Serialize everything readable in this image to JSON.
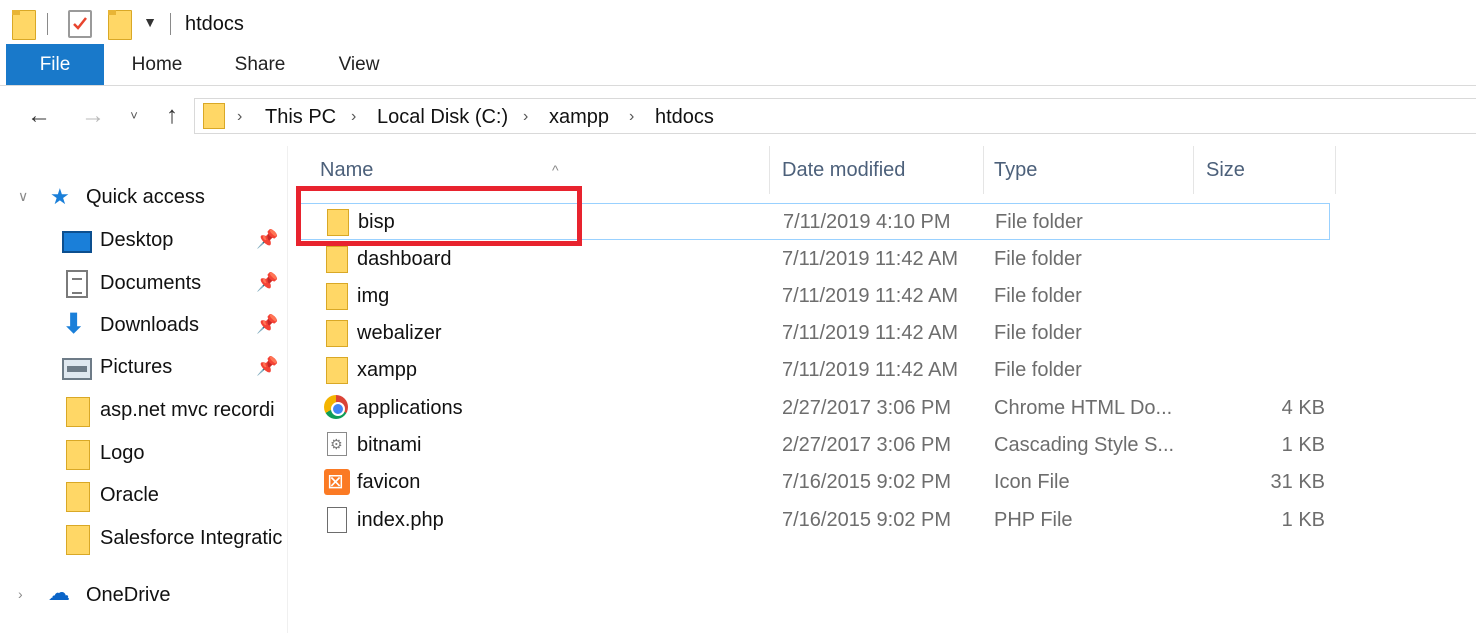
{
  "window": {
    "title": "htdocs"
  },
  "ribbon": {
    "tabs": [
      {
        "label": "File",
        "active": true
      },
      {
        "label": "Home"
      },
      {
        "label": "Share"
      },
      {
        "label": "View"
      }
    ]
  },
  "navigation": {
    "back": "←",
    "forward": "→",
    "recent": "˅",
    "up": "↑"
  },
  "address": {
    "crumbs": [
      "This PC",
      "Local Disk (C:)",
      "xampp",
      "htdocs"
    ],
    "separator": "›"
  },
  "navpane": {
    "quick_access": "Quick access",
    "items": [
      {
        "label": "Desktop",
        "icon": "desktop-icon",
        "pinned": true
      },
      {
        "label": "Documents",
        "icon": "documents-icon",
        "pinned": true
      },
      {
        "label": "Downloads",
        "icon": "downloads-icon",
        "pinned": true
      },
      {
        "label": "Pictures",
        "icon": "pictures-icon",
        "pinned": true
      },
      {
        "label": "asp.net mvc recordi",
        "icon": "folder-icon"
      },
      {
        "label": "Logo",
        "icon": "folder-icon"
      },
      {
        "label": "Oracle",
        "icon": "folder-icon"
      },
      {
        "label": "Salesforce Integratic",
        "icon": "folder-icon"
      }
    ],
    "onedrive": "OneDrive",
    "pin_glyph": "📌"
  },
  "filelist": {
    "columns": {
      "name": "Name",
      "date": "Date modified",
      "type": "Type",
      "size": "Size"
    },
    "sort_caret": "^",
    "rows": [
      {
        "name": "bisp",
        "date": "7/11/2019 4:10 PM",
        "type": "File folder",
        "size": "",
        "icon": "folder-icon",
        "selected": true
      },
      {
        "name": "dashboard",
        "date": "7/11/2019 11:42 AM",
        "type": "File folder",
        "size": "",
        "icon": "folder-icon"
      },
      {
        "name": "img",
        "date": "7/11/2019 11:42 AM",
        "type": "File folder",
        "size": "",
        "icon": "folder-icon"
      },
      {
        "name": "webalizer",
        "date": "7/11/2019 11:42 AM",
        "type": "File folder",
        "size": "",
        "icon": "folder-icon"
      },
      {
        "name": "xampp",
        "date": "7/11/2019 11:42 AM",
        "type": "File folder",
        "size": "",
        "icon": "folder-icon"
      },
      {
        "name": "applications",
        "date": "2/27/2017 3:06 PM",
        "type": "Chrome HTML Do...",
        "size": "4 KB",
        "icon": "chrome-icon"
      },
      {
        "name": "bitnami",
        "date": "2/27/2017 3:06 PM",
        "type": "Cascading Style S...",
        "size": "1 KB",
        "icon": "css-file-icon"
      },
      {
        "name": "favicon",
        "date": "7/16/2015 9:02 PM",
        "type": "Icon File",
        "size": "31 KB",
        "icon": "xampp-icon"
      },
      {
        "name": "index.php",
        "date": "7/16/2015 9:02 PM",
        "type": "PHP File",
        "size": "1 KB",
        "icon": "php-file-icon"
      }
    ]
  },
  "colors": {
    "file_tab": "#1979ca",
    "folder": "#ffd766",
    "selection_border": "#99d1ff",
    "annotation": "#e8232e"
  }
}
